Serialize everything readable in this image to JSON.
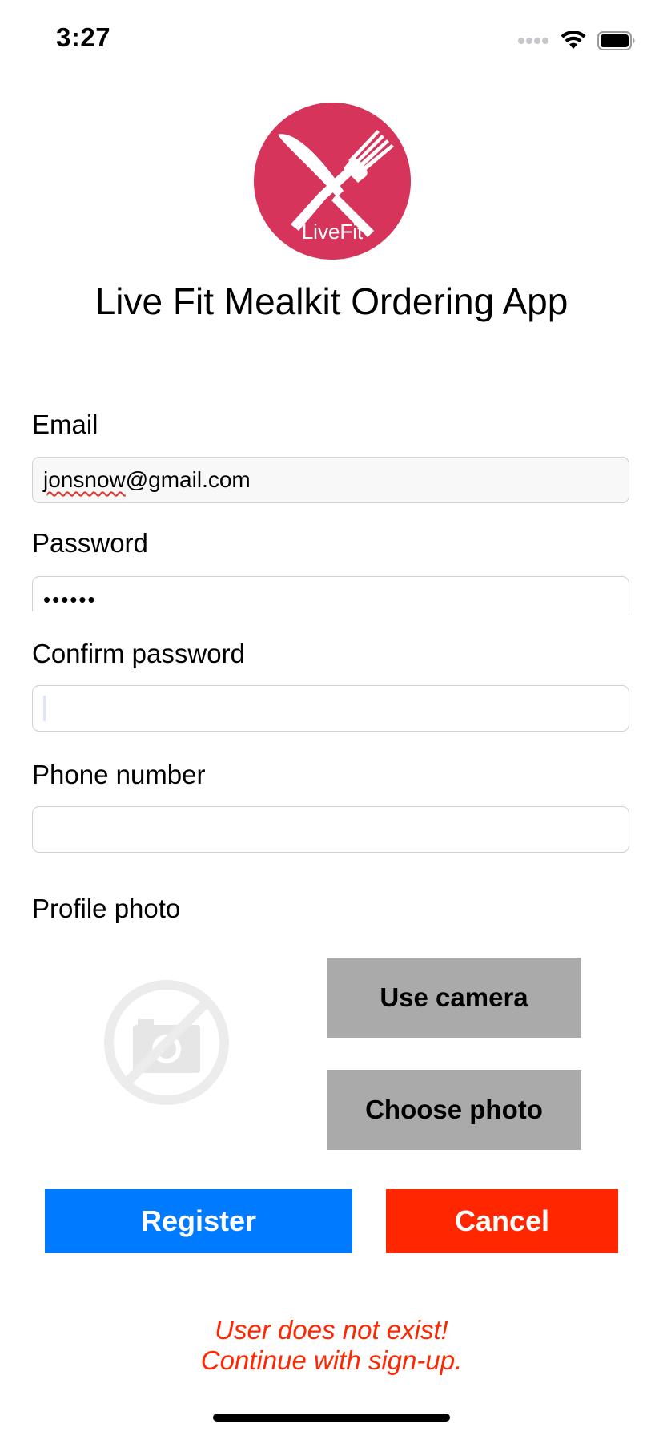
{
  "status_bar": {
    "time": "3:27",
    "icons": [
      "signal-icon",
      "wifi-icon",
      "battery-icon"
    ]
  },
  "logo": {
    "text": "LiveFit",
    "icon": "fork-knife-icon",
    "color": "#d6345b"
  },
  "app_title": "Live Fit Mealkit Ordering App",
  "form": {
    "email": {
      "label": "Email",
      "value": "jonsnow@gmail.com",
      "misspelled_part": "jonsnow",
      "rest": "@gmail.com"
    },
    "password": {
      "label": "Password",
      "value": "••••••"
    },
    "confirm_password": {
      "label": "Confirm password",
      "value": ""
    },
    "phone": {
      "label": "Phone number",
      "value": ""
    },
    "profile_photo": {
      "label": "Profile photo",
      "placeholder_icon": "no-camera-icon"
    }
  },
  "buttons": {
    "use_camera": "Use camera",
    "choose_photo": "Choose photo",
    "register": "Register",
    "cancel": "Cancel"
  },
  "colors": {
    "register": "#007aff",
    "cancel": "#ff2600",
    "message": "#ff2600",
    "gray_button": "#aaaaaa"
  },
  "message": {
    "line1": "User does not exist!",
    "line2": "Continue with sign-up."
  }
}
